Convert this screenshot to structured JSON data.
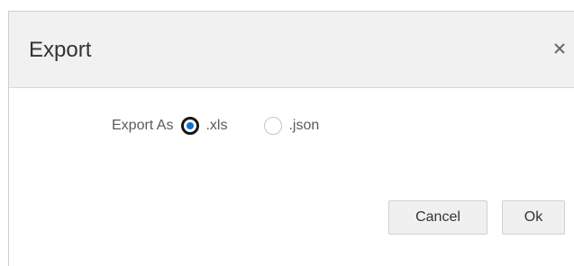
{
  "dialog": {
    "title": "Export",
    "close_icon": "close-icon",
    "export_as_label": "Export As",
    "options": [
      {
        "label": ".xls",
        "selected": true
      },
      {
        "label": ".json",
        "selected": false
      }
    ],
    "cancel_label": "Cancel",
    "ok_label": "Ok"
  },
  "colors": {
    "header_bg": "#f1f1f1",
    "radio_selected": "#0a72d0",
    "button_bg": "#f0f0f0"
  }
}
